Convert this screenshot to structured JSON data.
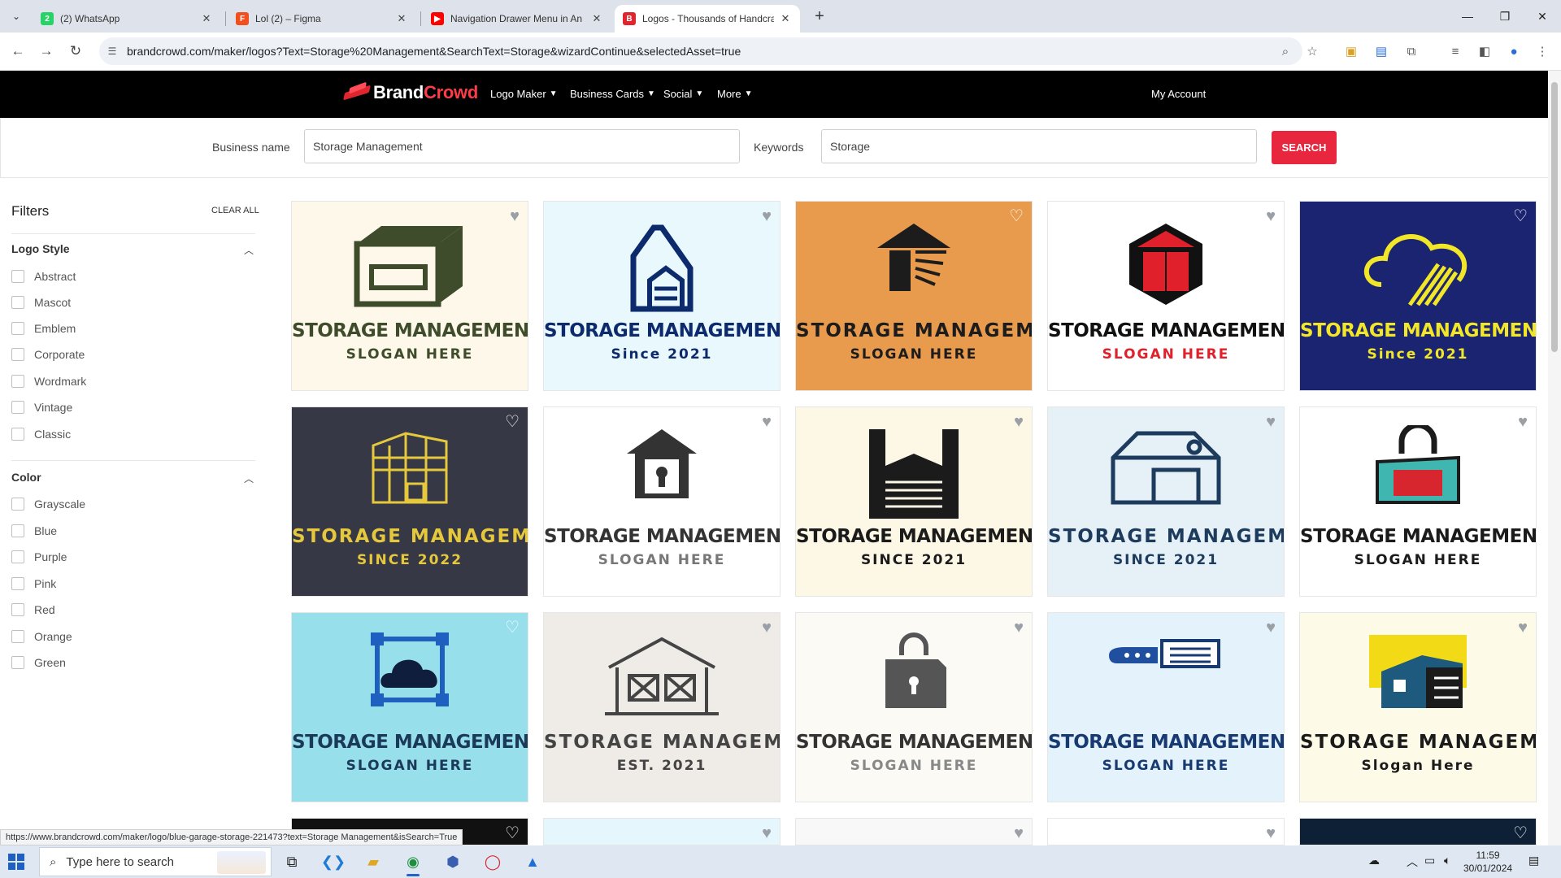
{
  "browser": {
    "tabs": [
      {
        "title": "(2) WhatsApp",
        "favicon": "whatsapp-icon",
        "color": "#25d366"
      },
      {
        "title": "Lol (2) – Figma",
        "favicon": "figma-icon",
        "color": "#f24e1e"
      },
      {
        "title": "Navigation Drawer Menu in An",
        "favicon": "youtube-icon",
        "color": "#ff0000"
      },
      {
        "title": "Logos - Thousands of Handcraf",
        "favicon": "brandcrowd-icon",
        "color": "#e0252f"
      }
    ],
    "url": "brandcrowd.com/maker/logos?Text=Storage%20Management&SearchText=Storage&wizardContinue&selectedAsset=true",
    "status_url": "https://www.brandcrowd.com/maker/logo/blue-garage-storage-221473?text=Storage Management&isSearch=True"
  },
  "site": {
    "brand_prefix": "Brand",
    "brand_suffix": "Crowd",
    "nav": [
      "Logo Maker",
      "Business Cards",
      "Social",
      "More"
    ],
    "account": "My Account",
    "accent_color": "#e8273e"
  },
  "search": {
    "business_label": "Business name",
    "business_value": "Storage Management",
    "keywords_label": "Keywords",
    "keywords_value": "Storage",
    "button": "SEARCH"
  },
  "filters": {
    "title": "Filters",
    "clear": "CLEAR ALL",
    "groups": [
      {
        "title": "Logo Style",
        "options": [
          "Abstract",
          "Mascot",
          "Emblem",
          "Corporate",
          "Wordmark",
          "Vintage",
          "Classic"
        ]
      },
      {
        "title": "Color",
        "options": [
          "Grayscale",
          "Blue",
          "Purple",
          "Pink",
          "Red",
          "Orange",
          "Green"
        ]
      }
    ]
  },
  "logos": [
    {
      "name": "STORAGE MANAGEMENT",
      "slogan": "SLOGAN HERE",
      "bg": "#fdf8ea",
      "fg": "#3f4c2b",
      "slogan_color": "#3f4c2b",
      "icon": "garage-box-icon",
      "heart": "#9aa0a6"
    },
    {
      "name": "STORAGE MANAGEMENT",
      "slogan": "Since 2021",
      "bg": "#e8f8fd",
      "fg": "#0d2a6c",
      "slogan_color": "#0d2a6c",
      "icon": "building-garage-icon",
      "heart": "#9aa0a6"
    },
    {
      "name": "STORAGE MANAGEMENT",
      "slogan": "SLOGAN HERE",
      "bg": "#e89a4d",
      "fg": "#1c1c1c",
      "slogan_color": "#1c1c1c",
      "icon": "shutter-house-icon",
      "heart": "#ffffff"
    },
    {
      "name": "STORAGE MANAGEMENT",
      "slogan": "SLOGAN HERE",
      "bg": "#ffffff",
      "fg": "#111111",
      "slogan_color": "#e0202a",
      "icon": "hexagon-garage-icon",
      "heart": "#9aa0a6"
    },
    {
      "name": "STORAGE MANAGEMENT",
      "slogan": "Since 2021",
      "bg": "#1b2470",
      "fg": "#f2e628",
      "slogan_color": "#f2e628",
      "icon": "cloud-arrows-icon",
      "heart": "#ffffff"
    },
    {
      "name": "STORAGE MANAGEMENT",
      "slogan": "SINCE 2022",
      "bg": "#363846",
      "fg": "#e5c83c",
      "slogan_color": "#e5c83c",
      "icon": "warehouse-icon",
      "heart": "#ffffff"
    },
    {
      "name": "STORAGE MANAGEMENT",
      "slogan": "SLOGAN HERE",
      "bg": "#ffffff",
      "fg": "#333333",
      "slogan_color": "#777777",
      "icon": "lock-house-icon",
      "heart": "#9aa0a6"
    },
    {
      "name": "STORAGE MANAGEMENT",
      "slogan": "SINCE 2021",
      "bg": "#fdf7e6",
      "fg": "#1b1b1b",
      "slogan_color": "#1b1b1b",
      "icon": "garage-door-icon",
      "heart": "#9aa0a6"
    },
    {
      "name": "STORAGE MANAGEMENT",
      "slogan": "SINCE 2021",
      "bg": "#e5f0f7",
      "fg": "#1d3b5c",
      "slogan_color": "#1d3b5c",
      "icon": "depot-icon",
      "heart": "#9aa0a6"
    },
    {
      "name": "STORAGE MANAGEMENT",
      "slogan": "SLOGAN HERE",
      "bg": "#ffffff",
      "fg": "#1b1b1b",
      "slogan_color": "#1b1b1b",
      "icon": "padlock-box-icon",
      "heart": "#9aa0a6"
    },
    {
      "name": "STORAGE MANAGEMENT",
      "slogan": "SLOGAN HERE",
      "bg": "#97dfeb",
      "fg": "#1b3a5a",
      "slogan_color": "#1b3a5a",
      "icon": "cloud-frame-icon",
      "heart": "#ffffff"
    },
    {
      "name": "STORAGE MANAGEMENT",
      "slogan": "EST. 2021",
      "bg": "#efebe7",
      "fg": "#444444",
      "slogan_color": "#444444",
      "icon": "crate-house-icon",
      "heart": "#9aa0a6"
    },
    {
      "name": "STORAGE MANAGEMENT",
      "slogan": "SLOGAN HERE",
      "bg": "#fbfaf5",
      "fg": "#333333",
      "slogan_color": "#888888",
      "icon": "lock-bag-icon",
      "heart": "#9aa0a6"
    },
    {
      "name": "STORAGE MANAGEMENT",
      "slogan": "SLOGAN HERE",
      "bg": "#e3f2fb",
      "fg": "#183a73",
      "slogan_color": "#183a73",
      "icon": "truck-icon",
      "heart": "#9aa0a6"
    },
    {
      "name": "STORAGE MANAGEMENT",
      "slogan": "Slogan Here",
      "bg": "#fdfbe8",
      "fg": "#1b1b1b",
      "slogan_color": "#1b1b1b",
      "icon": "yellow-warehouse-icon",
      "heart": "#9aa0a6"
    }
  ],
  "taskbar": {
    "search_placeholder": "Type here to search",
    "time": "11:59",
    "date": "30/01/2024"
  }
}
